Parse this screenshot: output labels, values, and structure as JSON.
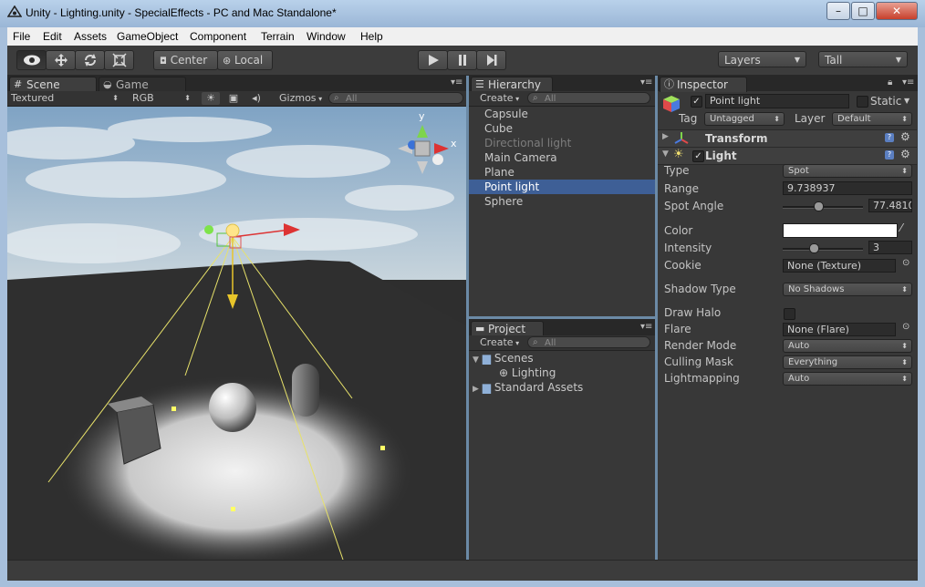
{
  "window": {
    "title": "Unity - Lighting.unity - SpecialEffects - PC and Mac Standalone*",
    "minimize_label": "–",
    "maximize_label": "□",
    "close_label": "✕"
  },
  "menu": [
    "File",
    "Edit",
    "Assets",
    "GameObject",
    "Component",
    "Terrain",
    "Window",
    "Help"
  ],
  "toolbar": {
    "pivot_label": "Center",
    "space_label": "Local",
    "layers_label": "Layers",
    "layout_label": "Tall"
  },
  "scene": {
    "tab_scene": "Scene",
    "tab_game": "Game",
    "render_mode": "Textured",
    "color_mode": "RGB",
    "gizmos_label": "Gizmos",
    "search_placeholder": "All",
    "axis_y": "y",
    "axis_x": "x"
  },
  "hierarchy": {
    "tab_label": "Hierarchy",
    "create_label": "Create",
    "search_placeholder": "All",
    "items": [
      {
        "label": "Capsule",
        "state": "normal"
      },
      {
        "label": "Cube",
        "state": "normal"
      },
      {
        "label": "Directional light",
        "state": "dim"
      },
      {
        "label": "Main Camera",
        "state": "normal"
      },
      {
        "label": "Plane",
        "state": "normal"
      },
      {
        "label": "Point light",
        "state": "selected"
      },
      {
        "label": "Sphere",
        "state": "normal"
      }
    ]
  },
  "project": {
    "tab_label": "Project",
    "create_label": "Create",
    "search_placeholder": "All",
    "scenes_folder": "Scenes",
    "lighting_scene": "Lighting",
    "standard_assets": "Standard Assets"
  },
  "inspector": {
    "tab_label": "Inspector",
    "object_name": "Point light",
    "static_label": "Static",
    "tag_label": "Tag",
    "tag_value": "Untagged",
    "layer_label": "Layer",
    "layer_value": "Default",
    "transform_label": "Transform",
    "light_label": "Light",
    "type_label": "Type",
    "type_value": "Spot",
    "range_label": "Range",
    "range_value": "9.738937",
    "spot_angle_label": "Spot Angle",
    "spot_angle_value": "77.4810",
    "color_label": "Color",
    "color_value": "#ffffff",
    "intensity_label": "Intensity",
    "intensity_value": "3",
    "cookie_label": "Cookie",
    "cookie_value": "None (Texture)",
    "shadow_type_label": "Shadow Type",
    "shadow_type_value": "No Shadows",
    "draw_halo_label": "Draw Halo",
    "flare_label": "Flare",
    "flare_value": "None (Flare)",
    "render_mode_label": "Render Mode",
    "render_mode_value": "Auto",
    "culling_mask_label": "Culling Mask",
    "culling_mask_value": "Everything",
    "lightmapping_label": "Lightmapping",
    "lightmapping_value": "Auto",
    "help_icon_label": "?"
  }
}
